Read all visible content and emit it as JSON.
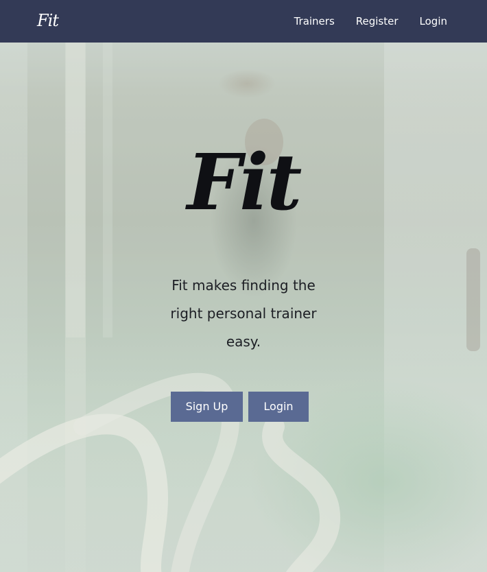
{
  "navbar": {
    "brand": "Fit",
    "links": [
      {
        "label": "Trainers"
      },
      {
        "label": "Register"
      },
      {
        "label": "Login"
      }
    ]
  },
  "hero": {
    "title": "Fit",
    "tagline": "Fit makes finding the right personal trainer easy.",
    "buttons": {
      "signup": "Sign Up",
      "login": "Login"
    }
  },
  "colors": {
    "navbar": "#333a56",
    "button": "#5a6a93",
    "title": "#0f1014"
  }
}
